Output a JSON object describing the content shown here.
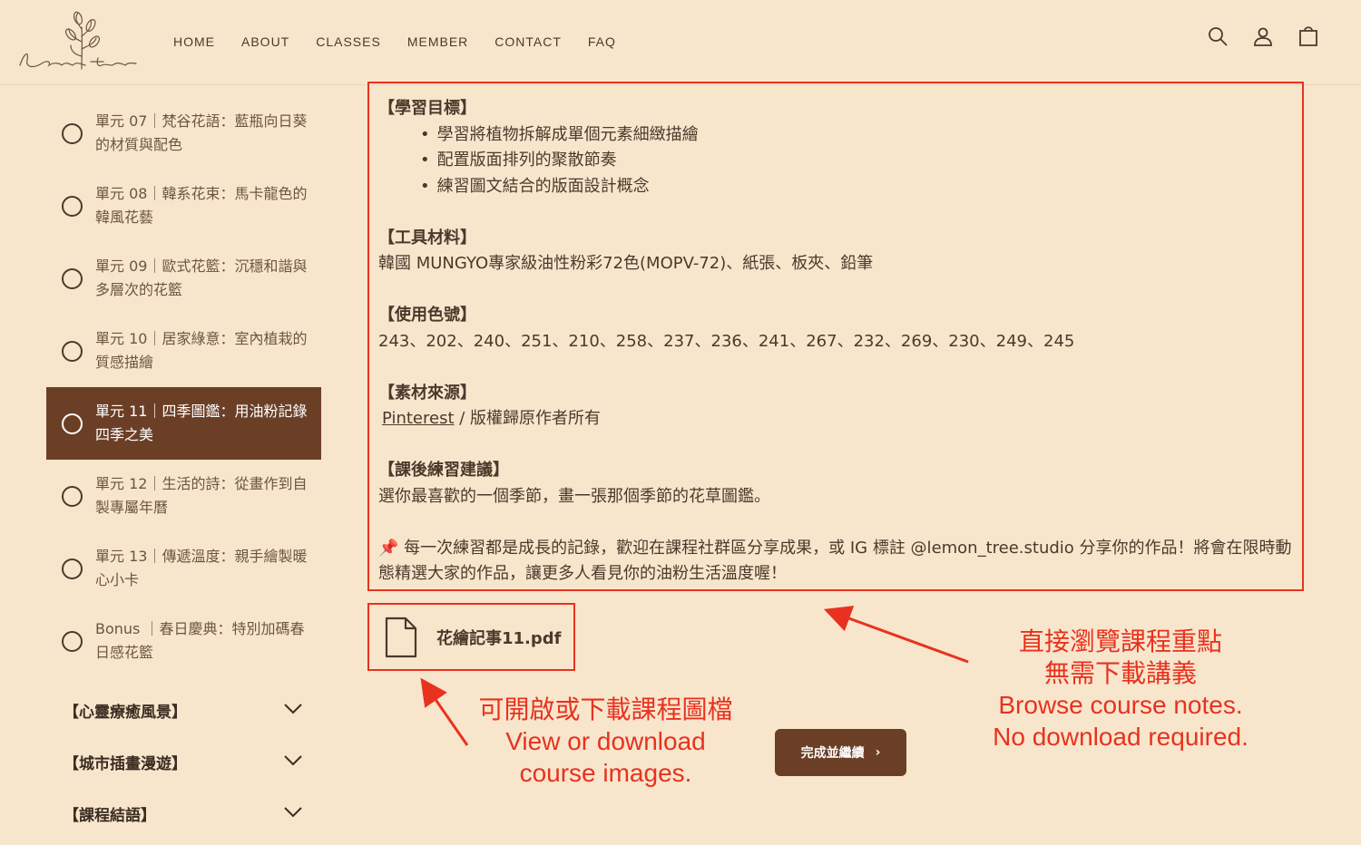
{
  "header": {
    "nav": [
      "HOME",
      "ABOUT",
      "CLASSES",
      "MEMBER",
      "CONTACT",
      "FAQ"
    ],
    "icons": [
      "search-icon",
      "account-icon",
      "cart-icon"
    ]
  },
  "sidebar": {
    "lessons": [
      {
        "label": "單元 07｜梵谷花語：藍瓶向日葵的材質與配色",
        "active": false
      },
      {
        "label": "單元 08｜韓系花束：馬卡龍色的韓風花藝",
        "active": false
      },
      {
        "label": "單元 09｜歐式花籃：沉穩和諧與多層次的花籃",
        "active": false
      },
      {
        "label": "單元 10｜居家綠意：室內植栽的質感描繪",
        "active": false
      },
      {
        "label": "單元 11｜四季圖鑑：用油粉記錄四季之美",
        "active": true
      },
      {
        "label": "單元 12｜生活的詩：從畫作到自製專屬年曆",
        "active": false
      },
      {
        "label": "單元 13｜傳遞溫度：親手繪製暖心小卡",
        "active": false
      },
      {
        "label": "Bonus ｜春日慶典：特別加碼春日感花籃",
        "active": false
      }
    ],
    "sections": [
      "【心靈療癒風景】",
      "【城市插畫漫遊】",
      "【課程結語】"
    ]
  },
  "content": {
    "goals_head": "【學習目標】",
    "goals": [
      "學習將植物拆解成單個元素細緻描繪",
      "配置版面排列的聚散節奏",
      "練習圖文結合的版面設計概念"
    ],
    "tools_head": "【工具材料】",
    "tools": "韓國 MUNGYO專家級油性粉彩72色(MOPV-72)、紙張、板夾、鉛筆",
    "colors_head": "【使用色號】",
    "colors": "243、202、240、251、210、258、237、236、241、267、232、269、230、249、245",
    "source_head": "【素材來源】",
    "source_link": "Pinterest",
    "source_text": " / 版權歸原作者所有",
    "practice_head": "【課後練習建議】",
    "practice": "選你最喜歡的一個季節，畫一張那個季節的花草圖鑑。",
    "pin_icon": "📌",
    "note": " 每一次練習都是成長的記錄，歡迎在課程社群區分享成果，或 IG 標註 @lemon_tree.studio 分享你的作品！將會在限時動態精選大家的作品，讓更多人看見你的油粉生活溫度喔！"
  },
  "file": {
    "name": "花繪記事11.pdf",
    "icon": "document-icon"
  },
  "complete_button": {
    "label": "完成並繼續",
    "arrow": "›"
  },
  "annotations": {
    "left": [
      "可開啟或下載課程圖檔",
      "View or download",
      "course images."
    ],
    "right": [
      "直接瀏覽課程重點",
      "無需下載講義",
      "Browse course notes.",
      "No download required."
    ],
    "color": "#e8321f"
  },
  "colors": {
    "background": "#f8e6cc",
    "accent": "#6b3f26",
    "annotation": "#e8321f"
  }
}
